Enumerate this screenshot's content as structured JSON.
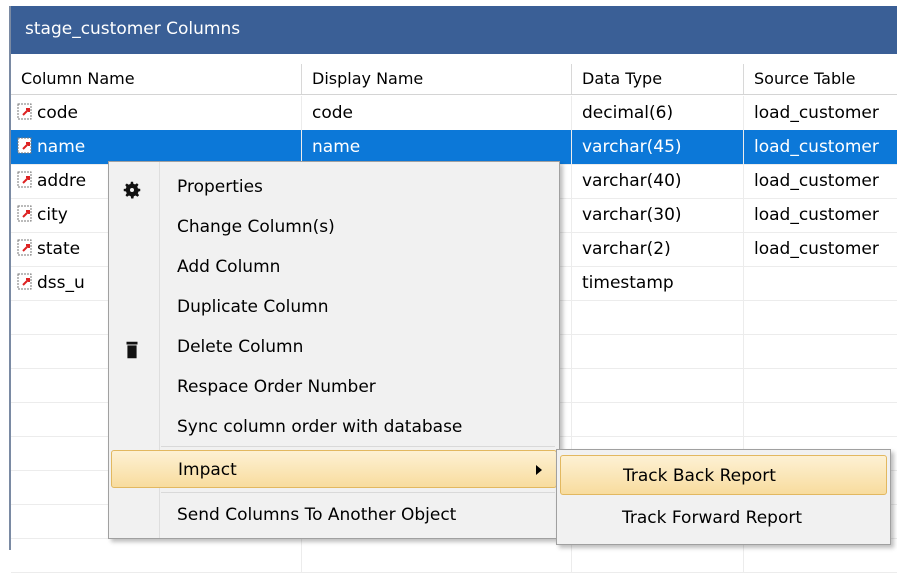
{
  "panel": {
    "title": "stage_customer Columns"
  },
  "columns": [
    "Column Name",
    "Display Name",
    "Data Type",
    "Source Table"
  ],
  "rows": [
    {
      "name": "code",
      "display": "code",
      "type": "decimal(6)",
      "source": "load_customer",
      "selected": false
    },
    {
      "name": "name",
      "display": "name",
      "type": "varchar(45)",
      "source": "load_customer",
      "selected": true
    },
    {
      "name": "addre",
      "display": "",
      "type": "varchar(40)",
      "source": "load_customer",
      "selected": false
    },
    {
      "name": "city",
      "display": "",
      "type": "varchar(30)",
      "source": "load_customer",
      "selected": false
    },
    {
      "name": "state",
      "display": "",
      "type": "varchar(2)",
      "source": "load_customer",
      "selected": false
    },
    {
      "name": "dss_u",
      "display": "",
      "type": "timestamp",
      "source": "",
      "selected": false
    }
  ],
  "context_menu": {
    "items": [
      {
        "label": "Properties",
        "icon": "gear-icon"
      },
      {
        "label": "Change Column(s)",
        "icon": ""
      },
      {
        "label": "Add Column",
        "icon": ""
      },
      {
        "label": "Duplicate Column",
        "icon": ""
      },
      {
        "label": "Delete Column",
        "icon": "trash-icon"
      },
      {
        "label": "Respace Order Number",
        "icon": ""
      },
      {
        "label": "Sync column order with database",
        "icon": ""
      },
      {
        "label": "Impact",
        "icon": "",
        "submenu": true,
        "highlighted": true
      },
      {
        "label": "Send Columns To Another Object",
        "icon": ""
      }
    ]
  },
  "submenu": {
    "items": [
      {
        "label": "Track Back Report",
        "highlighted": true
      },
      {
        "label": "Track Forward Report",
        "highlighted": false
      }
    ]
  },
  "colors": {
    "title_bar": "#3a5f96",
    "selection": "#0c78d8",
    "menu_highlight": "#f8dc9e"
  }
}
